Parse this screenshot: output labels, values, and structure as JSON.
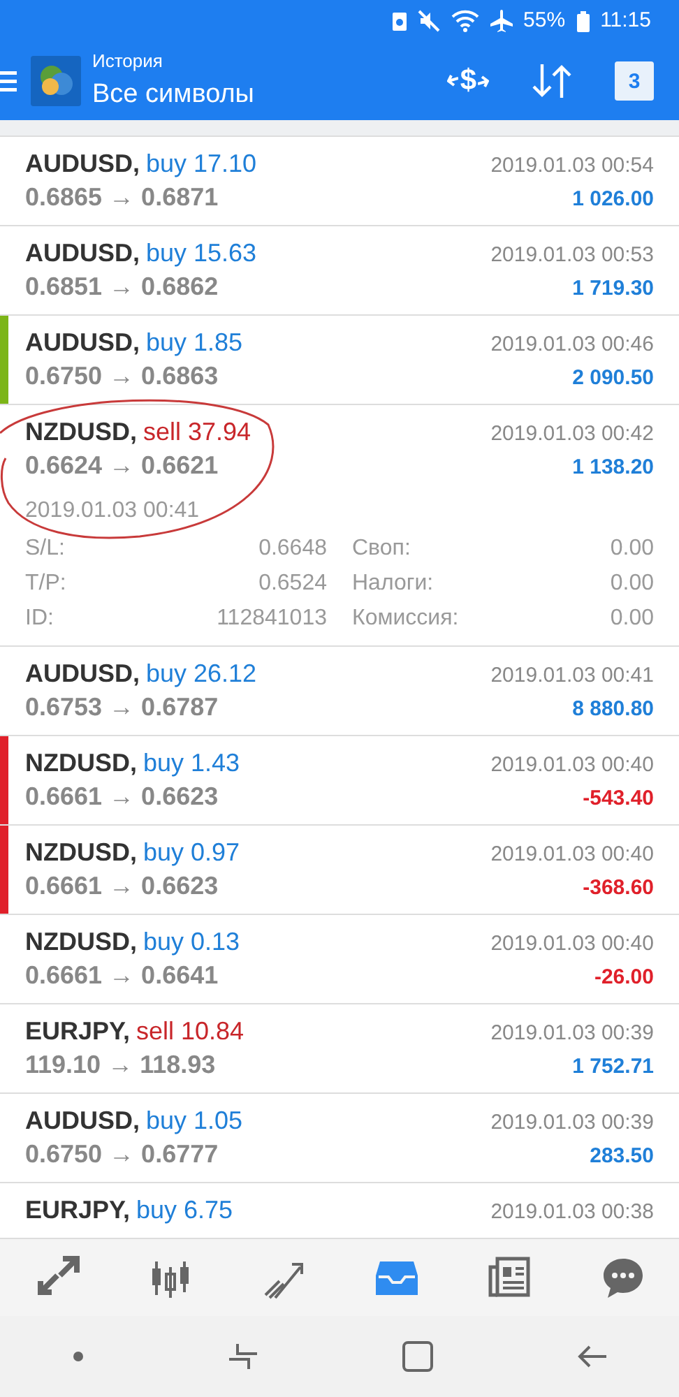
{
  "status_bar": {
    "battery": "55%",
    "time": "11:15"
  },
  "header": {
    "subtitle": "История",
    "title": "Все символы",
    "currency_glyph": "$",
    "calendar_day": "3"
  },
  "trades": [
    {
      "symbol": "AUDUSD,",
      "action": {
        "text": "buy 17.10",
        "kind": "buy"
      },
      "prices": "0.6865 → 0.6871",
      "time": "2019.01.03 00:54",
      "profit": {
        "text": "1 026.00",
        "kind": "gain"
      },
      "expanded": false
    },
    {
      "symbol": "AUDUSD,",
      "action": {
        "text": "buy 15.63",
        "kind": "buy"
      },
      "prices": "0.6851 → 0.6862",
      "time": "2019.01.03 00:53",
      "profit": {
        "text": "1 719.30",
        "kind": "gain"
      },
      "expanded": false
    },
    {
      "symbol": "AUDUSD,",
      "action": {
        "text": "buy 1.85",
        "kind": "buy"
      },
      "prices": "0.6750 → 0.6863",
      "time": "2019.01.03 00:46",
      "profit": {
        "text": "2 090.50",
        "kind": "gain"
      },
      "expanded": false,
      "color": "#7cb518"
    },
    {
      "symbol": "NZDUSD,",
      "action": {
        "text": "sell 37.94",
        "kind": "sell"
      },
      "prices": "0.6624 → 0.6621",
      "time": "2019.01.03 00:42",
      "profit": {
        "text": "1 138.20",
        "kind": "gain"
      },
      "expanded": true,
      "open_time": "2019.01.03 00:41",
      "details": [
        {
          "label": "S/L:",
          "value": "0.6648"
        },
        {
          "label": "Своп:",
          "value": "0.00"
        },
        {
          "label": "T/P:",
          "value": "0.6524"
        },
        {
          "label": "Налоги:",
          "value": "0.00"
        },
        {
          "label": "ID:",
          "value": "112841013"
        },
        {
          "label": "Комиссия:",
          "value": "0.00"
        }
      ]
    },
    {
      "symbol": "AUDUSD,",
      "action": {
        "text": "buy 26.12",
        "kind": "buy"
      },
      "prices": "0.6753 → 0.6787",
      "time": "2019.01.03 00:41",
      "profit": {
        "text": "8 880.80",
        "kind": "gain"
      },
      "expanded": false
    },
    {
      "symbol": "NZDUSD,",
      "action": {
        "text": "buy 1.43",
        "kind": "buy"
      },
      "prices": "0.6661 → 0.6623",
      "time": "2019.01.03 00:40",
      "profit": {
        "text": "-543.40",
        "kind": "loss"
      },
      "expanded": false,
      "color": "#e0202a"
    },
    {
      "symbol": "NZDUSD,",
      "action": {
        "text": "buy 0.97",
        "kind": "buy"
      },
      "prices": "0.6661 → 0.6623",
      "time": "2019.01.03 00:40",
      "profit": {
        "text": "-368.60",
        "kind": "loss"
      },
      "expanded": false,
      "color": "#e0202a"
    },
    {
      "symbol": "NZDUSD,",
      "action": {
        "text": "buy 0.13",
        "kind": "buy"
      },
      "prices": "0.6661 → 0.6641",
      "time": "2019.01.03 00:40",
      "profit": {
        "text": "-26.00",
        "kind": "loss"
      },
      "expanded": false
    },
    {
      "symbol": "EURJPY,",
      "action": {
        "text": "sell 10.84",
        "kind": "sell"
      },
      "prices": "119.10 → 118.93",
      "time": "2019.01.03 00:39",
      "profit": {
        "text": "1 752.71",
        "kind": "gain"
      },
      "expanded": false
    },
    {
      "symbol": "AUDUSD,",
      "action": {
        "text": "buy 1.05",
        "kind": "buy"
      },
      "prices": "0.6750 → 0.6777",
      "time": "2019.01.03 00:39",
      "profit": {
        "text": "283.50",
        "kind": "gain"
      },
      "expanded": false
    },
    {
      "symbol": "EURJPY,",
      "action": {
        "text": "buy 6.75",
        "kind": "buy"
      },
      "time": "2019.01.03 00:38",
      "expanded": false
    }
  ],
  "bottom_tabs": [
    {
      "kind": "quotes",
      "selected": false
    },
    {
      "kind": "chart",
      "selected": false
    },
    {
      "kind": "trade",
      "selected": false
    },
    {
      "kind": "history",
      "selected": true
    },
    {
      "kind": "news",
      "selected": false
    },
    {
      "kind": "chat",
      "selected": false
    }
  ]
}
